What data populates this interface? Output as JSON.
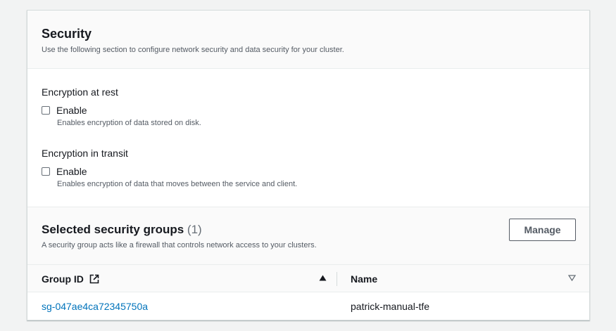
{
  "security": {
    "title": "Security",
    "description": "Use the following section to configure network security and data security for your cluster.",
    "encryption_at_rest": {
      "label": "Encryption at rest",
      "checkbox_label": "Enable",
      "checked": false,
      "help": "Enables encryption of data stored on disk."
    },
    "encryption_in_transit": {
      "label": "Encryption in transit",
      "checkbox_label": "Enable",
      "checked": false,
      "help": "Enables encryption of data that moves between the service and client."
    }
  },
  "security_groups": {
    "title": "Selected security groups",
    "count": "(1)",
    "description": "A security group acts like a firewall that controls network access to your clusters.",
    "manage_label": "Manage",
    "columns": {
      "group_id": "Group ID",
      "name": "Name"
    },
    "rows": [
      {
        "group_id": "sg-047ae4ca72345750a",
        "name": "patrick-manual-tfe"
      }
    ]
  },
  "colors": {
    "link": "#0073bb",
    "text": "#16191f",
    "secondary_text": "#545b64"
  }
}
